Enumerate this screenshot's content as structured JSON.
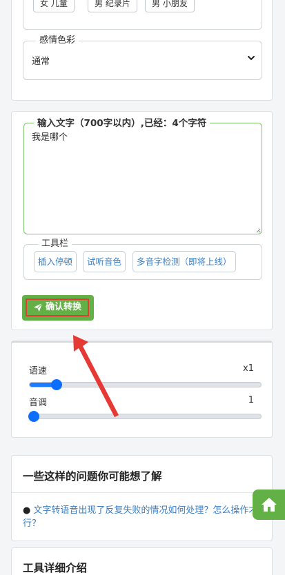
{
  "voice": {
    "chips": [
      "女 儿童",
      "男 纪录片",
      "男 小朋友"
    ]
  },
  "emotion": {
    "legend": "感情色彩",
    "selected": "通常"
  },
  "text_input": {
    "legend_prefix": "输入文字（700字以内）",
    "legend_suffix": ",已经：4个字符",
    "value": "我是哪个"
  },
  "toolbar": {
    "legend": "工具栏",
    "buttons": [
      "插入停顿",
      "试听音色",
      "多音字检测（即将上线）"
    ]
  },
  "confirm": {
    "label": "确认转换"
  },
  "sliders": {
    "speed": {
      "label": "语速",
      "value_text": "x1",
      "position": 0.11
    },
    "pitch": {
      "label": "音调",
      "value_text": "1",
      "position": 0.0
    }
  },
  "faq": {
    "title": "一些这样的问题你可能想了解",
    "items": [
      "文字转语音出现了反复失败的情况如何处理？怎么操作才行？"
    ]
  },
  "intro": {
    "title": "工具详细介绍"
  },
  "colors": {
    "accent_green": "#63b046",
    "link_blue": "#3a7fc1",
    "slider_blue": "#0d6efd",
    "annotation_red": "#e53935"
  }
}
